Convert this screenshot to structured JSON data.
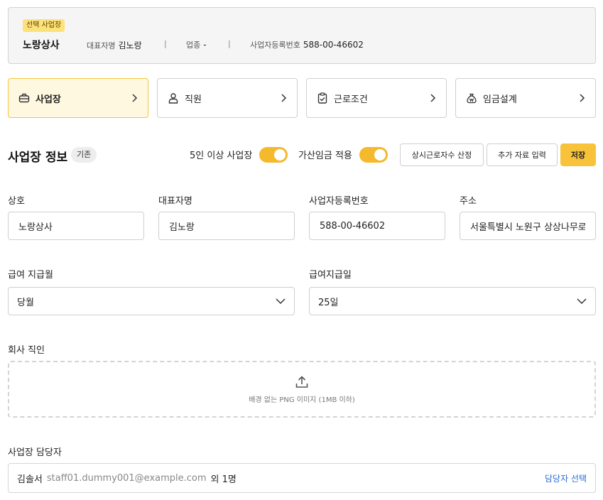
{
  "summary": {
    "badge": "선택 사업장",
    "company": "노랑상사",
    "rep_label": "대표자명",
    "rep_value": "김노랑",
    "industry_label": "업종",
    "industry_value": "-",
    "regno_label": "사업자등록번호",
    "regno_value": "588-00-46602",
    "separator": "|"
  },
  "nav": [
    {
      "label": "사업장",
      "icon": "briefcase-icon",
      "active": true
    },
    {
      "label": "직원",
      "icon": "person-icon",
      "active": false
    },
    {
      "label": "근로조건",
      "icon": "clipboard-check-icon",
      "active": false
    },
    {
      "label": "임금설계",
      "icon": "money-bag-icon",
      "active": false
    }
  ],
  "section": {
    "title": "사업장 정보",
    "badge": "기존",
    "toggle1_label": "5인 이상 사업장",
    "toggle1_on": true,
    "toggle2_label": "가산임금 적용",
    "toggle2_on": true,
    "btn_headcount": "상시근로자수 산정",
    "btn_extra": "추가 자료 입력",
    "btn_save": "저장"
  },
  "form": {
    "company_label": "상호",
    "company_value": "노랑상사",
    "rep_label": "대표자명",
    "rep_value": "김노랑",
    "regno_label": "사업자등록번호",
    "regno_value": "588-00-46602",
    "address_label": "주소",
    "address_value": "서울특별시 노원구 상상나무로",
    "pay_month_label": "급여 지급월",
    "pay_month_value": "당월",
    "pay_day_label": "급여지급일",
    "pay_day_value": "25일",
    "seal_label": "회사 직인",
    "seal_hint": "배경 없는 PNG 이미지 (1MB 이하)",
    "manager_label": "사업장 담당자",
    "manager_name": "김솔서",
    "manager_email": "staff01.dummy001@example.com",
    "manager_more": "외 1명",
    "manager_select": "담당자 선택"
  },
  "colors": {
    "accent": "#f8c33a",
    "accent_light": "#fff8e1",
    "link": "#2a6fd6"
  }
}
